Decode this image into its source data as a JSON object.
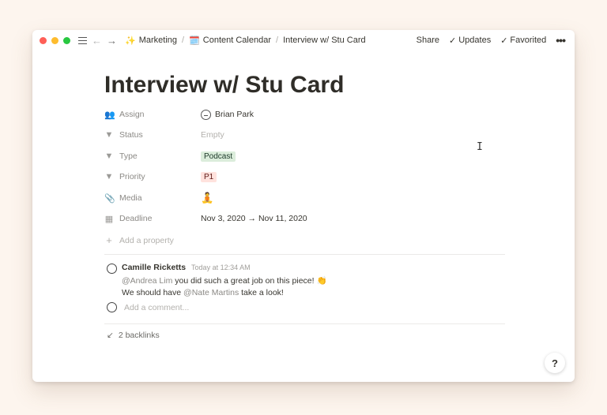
{
  "topbar": {
    "breadcrumb": [
      {
        "emoji": "✨",
        "label": "Marketing"
      },
      {
        "emoji": "🗓️",
        "label": "Content Calendar"
      },
      {
        "emoji": "",
        "label": "Interview w/ Stu Card"
      }
    ],
    "separator": "/",
    "share_label": "Share",
    "updates_label": "Updates",
    "favorited_label": "Favorited",
    "more_label": "•••"
  },
  "page": {
    "title": "Interview w/ Stu Card",
    "properties": {
      "assign": {
        "name": "Assign",
        "value": "Brian Park"
      },
      "status": {
        "name": "Status",
        "value": "Empty"
      },
      "type": {
        "name": "Type",
        "value": "Podcast"
      },
      "priority": {
        "name": "Priority",
        "value": "P1"
      },
      "media": {
        "name": "Media"
      },
      "deadline": {
        "name": "Deadline",
        "value": "Nov 3, 2020 → Nov 11, 2020"
      }
    },
    "add_property_label": "Add a property"
  },
  "comments": {
    "author": "Camille Ricketts",
    "time": "Today at 12:34 AM",
    "line1_mention": "@Andrea Lim",
    "line1_text": " you did such a great job on this piece! 👏",
    "line2_prefix": "We should have ",
    "line2_mention": "@Nate Martins",
    "line2_suffix": " take a look!",
    "add_placeholder": "Add a comment..."
  },
  "backlinks": {
    "label": "2 backlinks"
  },
  "help": {
    "label": "?"
  },
  "colors": {
    "tag_podcast_bg": "#dbeddb",
    "tag_p1_bg": "#ffe2dd",
    "close": "#ff5f57",
    "minimize": "#febc2e",
    "zoom": "#28c840"
  }
}
